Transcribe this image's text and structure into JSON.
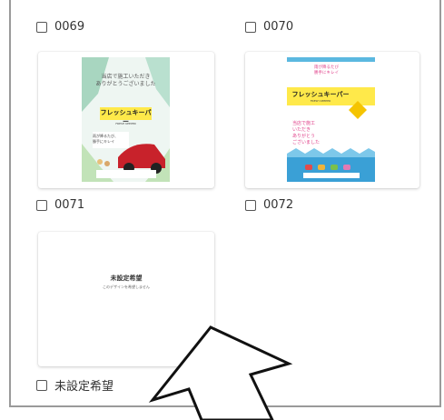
{
  "items": [
    {
      "id": "0069"
    },
    {
      "id": "0070"
    },
    {
      "id": "0071"
    },
    {
      "id": "0072"
    },
    {
      "id": "未設定希望"
    }
  ],
  "flyer71": {
    "headline1": "当店で施工いただき",
    "headline2": "ありがとうございました",
    "banner": "フレッシュキーパー",
    "banner_sub": "FRESH KEEPER",
    "body1": "雨が降るたび、",
    "body2": "勝手にキレイ"
  },
  "flyer72": {
    "top1": "雨が降るたび",
    "top2": "勝手にキレイ",
    "banner": "フレッシュキーパー",
    "banner_sub": "FRESH KEEPER",
    "pink1": "当店で施工",
    "pink2": "いただき",
    "pink3": "ありがとう",
    "pink4": "ございました"
  },
  "unset": {
    "title": "未設定希望",
    "subtitle": "このデザインを希望しません"
  }
}
